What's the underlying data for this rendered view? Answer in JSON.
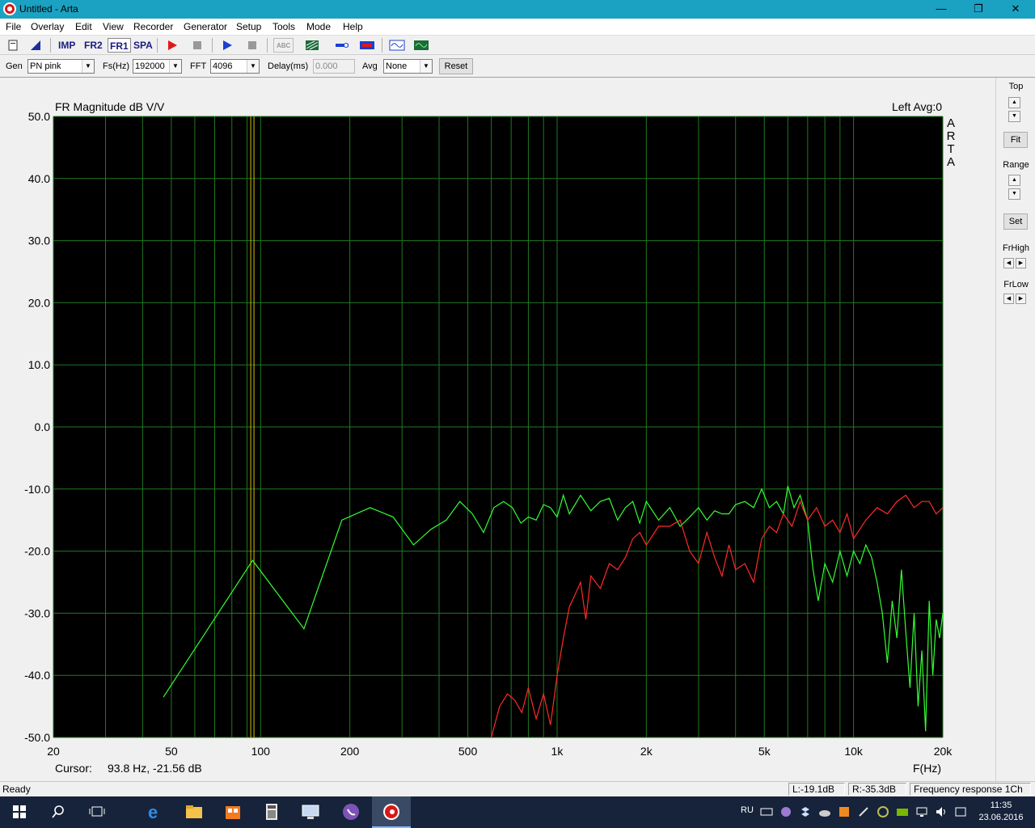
{
  "window": {
    "title": "Untitled - Arta",
    "minimize": "—",
    "restore": "❐",
    "close": "✕"
  },
  "menu": [
    "File",
    "Overlay",
    "Edit",
    "View",
    "Recorder",
    "Generator",
    "Setup",
    "Tools",
    "Mode",
    "Help"
  ],
  "toolbar": {
    "imp": "IMP",
    "fr2": "FR2",
    "fr1": "FR1",
    "spa": "SPA",
    "abc": "ABC"
  },
  "controls": {
    "gen_label": "Gen",
    "gen_value": "PN pink",
    "fs_label": "Fs(Hz)",
    "fs_value": "192000",
    "fft_label": "FFT",
    "fft_value": "4096",
    "delay_label": "Delay(ms)",
    "delay_value": "0.000",
    "avg_label": "Avg",
    "avg_value": "None",
    "reset": "Reset"
  },
  "plot": {
    "title": "FR Magnitude dB V/V",
    "channel_info": "Left  Avg:0",
    "brand": "ARTA",
    "cursor_label": "Cursor:",
    "cursor_value": "93.8 Hz, -21.56 dB",
    "x_unit": "F(Hz)"
  },
  "chart_data": {
    "type": "line",
    "title": "FR Magnitude dB V/V",
    "xlabel": "F(Hz)",
    "ylabel": "",
    "xscale": "log",
    "xlim": [
      20,
      20000
    ],
    "ylim": [
      -50,
      50
    ],
    "grid": true,
    "background": "#000000",
    "grid_color": "#1f7a1f",
    "x_ticks": [
      20,
      50,
      100,
      200,
      500,
      1000,
      2000,
      5000,
      10000,
      20000
    ],
    "x_tick_labels": [
      "20",
      "50",
      "100",
      "200",
      "500",
      "1k",
      "2k",
      "5k",
      "10k",
      "20k"
    ],
    "y_ticks": [
      50,
      40,
      30,
      20,
      10,
      0,
      -10,
      -20,
      -30,
      -40,
      -50
    ],
    "y_tick_labels": [
      "50.0",
      "40.0",
      "30.0",
      "20.0",
      "10.0",
      "0.0",
      "-10.0",
      "-20.0",
      "-30.0",
      "-40.0",
      "-50.0"
    ],
    "cursor_x": 93.8,
    "cursor_color": "#d4c000",
    "series": [
      {
        "color": "#33ff33",
        "x": [
          47,
          94,
          140,
          188,
          234,
          280,
          328,
          375,
          423,
          470,
          518,
          565,
          612,
          660,
          707,
          755,
          800,
          850,
          900,
          950,
          1000,
          1050,
          1100,
          1150,
          1200,
          1300,
          1400,
          1500,
          1600,
          1700,
          1800,
          1900,
          2000,
          2200,
          2400,
          2600,
          2800,
          3000,
          3200,
          3400,
          3600,
          3800,
          4000,
          4300,
          4600,
          4900,
          5200,
          5500,
          5800,
          6000,
          6300,
          6600,
          7000,
          7300,
          7600,
          8000,
          8500,
          9000,
          9500,
          10000,
          10500,
          11000,
          11500,
          12000,
          12500,
          13000,
          13500,
          14000,
          14500,
          15000,
          15500,
          16000,
          16500,
          17000,
          17500,
          18000,
          18500,
          19000,
          19500,
          20000
        ],
        "y": [
          -43.5,
          -21.5,
          -32.5,
          -15,
          -13,
          -14.5,
          -19,
          -16.5,
          -15,
          -12,
          -14,
          -17,
          -13,
          -12,
          -13,
          -15.5,
          -14.5,
          -15,
          -12.5,
          -13,
          -14.5,
          -11,
          -14,
          -12.5,
          -11,
          -13.5,
          -12,
          -11.5,
          -15,
          -13,
          -12,
          -15.5,
          -12,
          -15,
          -13,
          -16,
          -14.5,
          -13,
          -15,
          -13.5,
          -14,
          -14,
          -12.5,
          -12,
          -13,
          -10,
          -13,
          -12,
          -14,
          -9.5,
          -13,
          -11,
          -15,
          -23,
          -28,
          -22,
          -25,
          -20,
          -24,
          -20,
          -22,
          -19,
          -21,
          -25,
          -30,
          -38,
          -28,
          -34,
          -23,
          -33,
          -42,
          -30,
          -45,
          -36,
          -49,
          -28,
          -40,
          -31,
          -34,
          -30
        ]
      },
      {
        "color": "#ff2a2a",
        "x": [
          600,
          640,
          680,
          720,
          760,
          800,
          850,
          900,
          950,
          1000,
          1050,
          1100,
          1150,
          1200,
          1250,
          1300,
          1400,
          1500,
          1600,
          1700,
          1800,
          1900,
          2000,
          2200,
          2400,
          2600,
          2800,
          3000,
          3200,
          3400,
          3600,
          3800,
          4000,
          4300,
          4600,
          4900,
          5200,
          5500,
          5800,
          6200,
          6600,
          7000,
          7500,
          8000,
          8500,
          9000,
          9500,
          10000,
          11000,
          12000,
          13000,
          14000,
          15000,
          16000,
          17000,
          18000,
          19000,
          20000
        ],
        "y": [
          -50,
          -45,
          -43,
          -44,
          -46,
          -42,
          -47,
          -43,
          -48,
          -40,
          -34,
          -29,
          -27,
          -25,
          -31,
          -24,
          -26,
          -22,
          -23,
          -21,
          -18,
          -17,
          -19,
          -16,
          -16,
          -15,
          -20,
          -22,
          -17,
          -21,
          -24,
          -19,
          -23,
          -22,
          -25,
          -18,
          -16,
          -17,
          -14,
          -16,
          -12,
          -15,
          -13,
          -16,
          -15,
          -17,
          -14,
          -18,
          -15,
          -13,
          -14,
          -12,
          -11,
          -13,
          -12,
          -12,
          -14,
          -13
        ]
      }
    ]
  },
  "right_panel": {
    "top": "Top",
    "fit": "Fit",
    "range": "Range",
    "set": "Set",
    "frhigh": "FrHigh",
    "frlow": "FrLow"
  },
  "status": {
    "ready": "Ready",
    "left_level": "L:-19.1dB",
    "right_level": "R:-35.3dB",
    "mode": "Frequency response 1Ch"
  },
  "taskbar": {
    "lang": "RU",
    "time": "11:35",
    "date": "23.06.2016"
  }
}
